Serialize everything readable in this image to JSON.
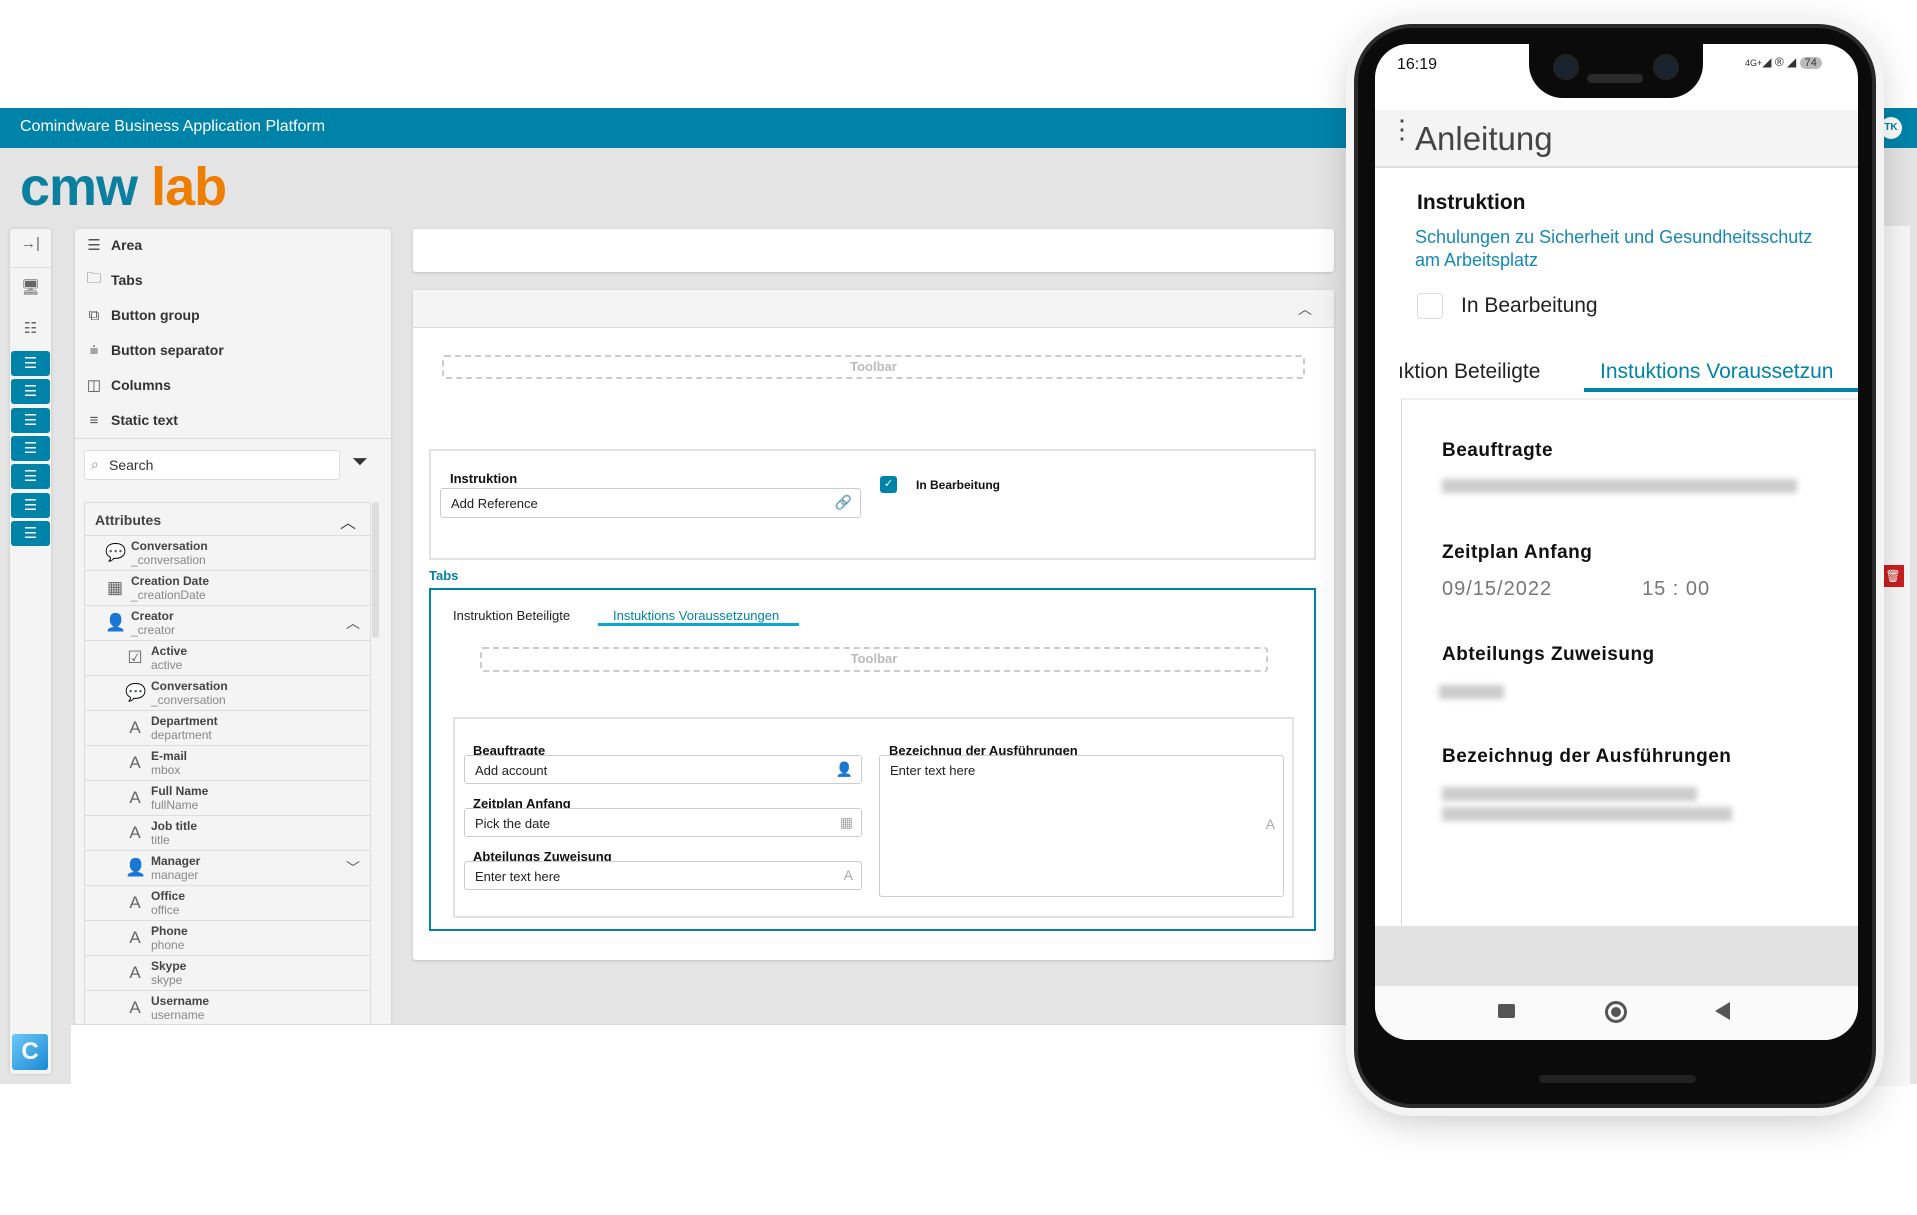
{
  "app": {
    "title": "Comindware Business Application Platform",
    "logo_text_1": "cmw",
    "logo_text_2": "lab",
    "user_initials": "TK"
  },
  "colors": {
    "brand": "#0083a9",
    "logo_blue": "#0a7f9e",
    "logo_orange": "#ee7d00",
    "danger": "#c8201e"
  },
  "rail": {
    "icons": [
      "collapse-icon",
      "desktop-icon",
      "checklist-icon",
      "list-icon",
      "list-icon",
      "list-icon",
      "list-icon",
      "list-icon",
      "list-icon",
      "list-icon"
    ],
    "bottom_button": "C"
  },
  "palette": {
    "items": [
      {
        "label": "Area",
        "icon": "☰"
      },
      {
        "label": "Tabs",
        "icon": "🗀"
      },
      {
        "label": "Button group",
        "icon": "⧉"
      },
      {
        "label": "Button separator",
        "icon": "⩧"
      },
      {
        "label": "Columns",
        "icon": "◫"
      },
      {
        "label": "Static text",
        "icon": "≡"
      }
    ],
    "search_placeholder": "Search",
    "attributes_header": "Attributes",
    "attributes": [
      {
        "name": "Conversation",
        "key": "_conversation",
        "icon": "💬",
        "level": 0
      },
      {
        "name": "Creation Date",
        "key": "_creationDate",
        "icon": "▦",
        "level": 0
      },
      {
        "name": "Creator",
        "key": "_creator",
        "icon": "👤",
        "level": 0,
        "expanded": true
      },
      {
        "name": "Active",
        "key": "active",
        "icon": "☑",
        "level": 1
      },
      {
        "name": "Conversation",
        "key": "_conversation",
        "icon": "💬",
        "level": 1
      },
      {
        "name": "Department",
        "key": "department",
        "icon": "A",
        "level": 1
      },
      {
        "name": "E-mail",
        "key": "mbox",
        "icon": "A",
        "level": 1
      },
      {
        "name": "Full Name",
        "key": "fullName",
        "icon": "A",
        "level": 1
      },
      {
        "name": "Job title",
        "key": "title",
        "icon": "A",
        "level": 1
      },
      {
        "name": "Manager",
        "key": "manager",
        "icon": "👤",
        "level": 1,
        "expanded": false
      },
      {
        "name": "Office",
        "key": "office",
        "icon": "A",
        "level": 1
      },
      {
        "name": "Phone",
        "key": "phone",
        "icon": "A",
        "level": 1
      },
      {
        "name": "Skype",
        "key": "skype",
        "icon": "A",
        "level": 1
      },
      {
        "name": "Username",
        "key": "username",
        "icon": "A",
        "level": 1
      }
    ]
  },
  "form": {
    "toolbar_placeholder": "Toolbar",
    "instruktion_label": "Instruktion",
    "instruktion_placeholder": "Add Reference",
    "in_bearbeitung_label": "In Bearbeitung",
    "in_bearbeitung_checked": true,
    "tabs_label": "Tabs",
    "tabs": [
      "Instruktion Beteiligte",
      "Instuktions Voraussetzungen"
    ],
    "active_tab": 1,
    "inner_toolbar_placeholder": "Toolbar",
    "beauftragte_label": "Beauftragte",
    "beauftragte_placeholder": "Add account",
    "zeitplan_label": "Zeitplan Anfang",
    "zeitplan_placeholder": "Pick the date",
    "abteilung_label": "Abteilungs Zuweisung",
    "abteilung_placeholder": "Enter text here",
    "bezeichnung_label": "Bezeichnug der Ausführungen",
    "bezeichnung_placeholder": "Enter text here"
  },
  "mobile": {
    "status_time": "16:19",
    "status_network": "4G+",
    "battery": "74",
    "title": "Anleitung",
    "instruktion_label": "Instruktion",
    "instruktion_link": "Schulungen zu Sicherheit und Gesundheitsschutz am Arbeitsplatz",
    "in_bearbeitung_label": "In Bearbeitung",
    "in_bearbeitung_checked": false,
    "tabs": [
      "ıktion Beteiligte",
      "Instuktions Voraussetzun"
    ],
    "active_tab": 1,
    "beauftragte_label": "Beauftragte",
    "zeitplan_label": "Zeitplan Anfang",
    "zeitplan_date": "09/15/2022",
    "zeitplan_time": "15 : 00",
    "abteilung_label": "Abteilungs Zuweisung",
    "bezeichnung_label": "Bezeichnug der Ausführungen"
  }
}
